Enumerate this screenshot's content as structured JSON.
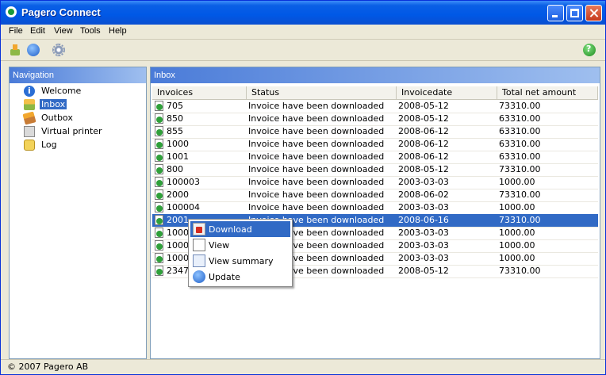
{
  "window": {
    "title": "Pagero Connect"
  },
  "menubar": {
    "items": [
      "File",
      "Edit",
      "View",
      "Tools",
      "Help"
    ]
  },
  "toolbar": {
    "icons": [
      "upload-icon",
      "refresh-icon",
      "settings-icon",
      "help-icon"
    ]
  },
  "navigation": {
    "title": "Navigation",
    "items": [
      {
        "label": "Welcome",
        "icon": "info-icon"
      },
      {
        "label": "Inbox",
        "icon": "inbox-icon",
        "selected": true
      },
      {
        "label": "Outbox",
        "icon": "outbox-icon"
      },
      {
        "label": "Virtual printer",
        "icon": "printer-icon"
      },
      {
        "label": "Log",
        "icon": "log-icon"
      }
    ]
  },
  "inbox": {
    "title": "Inbox",
    "columns": [
      "Invoices",
      "Status",
      "Invoicedate",
      "Total net amount"
    ],
    "rows": [
      {
        "invoice": "705",
        "status": "Invoice have been downloaded",
        "date": "2008-05-12",
        "amount": "73310.00"
      },
      {
        "invoice": "850",
        "status": "Invoice have been downloaded",
        "date": "2008-05-12",
        "amount": "63310.00"
      },
      {
        "invoice": "855",
        "status": "Invoice have been downloaded",
        "date": "2008-06-12",
        "amount": "63310.00"
      },
      {
        "invoice": "1000",
        "status": "Invoice have been downloaded",
        "date": "2008-06-12",
        "amount": "63310.00"
      },
      {
        "invoice": "1001",
        "status": "Invoice have been downloaded",
        "date": "2008-06-12",
        "amount": "63310.00"
      },
      {
        "invoice": "800",
        "status": "Invoice have been downloaded",
        "date": "2008-05-12",
        "amount": "73310.00"
      },
      {
        "invoice": "100003",
        "status": "Invoice have been downloaded",
        "date": "2003-03-03",
        "amount": "1000.00"
      },
      {
        "invoice": "2000",
        "status": "Invoice have been downloaded",
        "date": "2008-06-02",
        "amount": "73310.00"
      },
      {
        "invoice": "100004",
        "status": "Invoice have been downloaded",
        "date": "2003-03-03",
        "amount": "1000.00"
      },
      {
        "invoice": "2001",
        "status": "Invoice have been downloaded",
        "date": "2008-06-16",
        "amount": "73310.00",
        "selected": true
      },
      {
        "invoice": "10000",
        "status": "Invoice have been downloaded",
        "date": "2003-03-03",
        "amount": "1000.00"
      },
      {
        "invoice": "10000",
        "status": "Invoice have been downloaded",
        "date": "2003-03-03",
        "amount": "1000.00"
      },
      {
        "invoice": "10000",
        "status": "Invoice have been downloaded",
        "date": "2003-03-03",
        "amount": "1000.00"
      },
      {
        "invoice": "23478",
        "status": "Invoice have been downloaded",
        "date": "2008-05-12",
        "amount": "73310.00"
      }
    ]
  },
  "context_menu": {
    "items": [
      {
        "label": "Download",
        "icon": "download-icon",
        "highlighted": true
      },
      {
        "label": "View",
        "icon": "view-icon"
      },
      {
        "label": "View summary",
        "icon": "summary-icon"
      },
      {
        "label": "Update",
        "icon": "update-icon"
      }
    ]
  },
  "statusbar": {
    "text": "© 2007 Pagero AB"
  },
  "colors": {
    "selection": "#316ac5",
    "titlebar": "#0058e6",
    "panel_header": "#4a7bd8"
  }
}
